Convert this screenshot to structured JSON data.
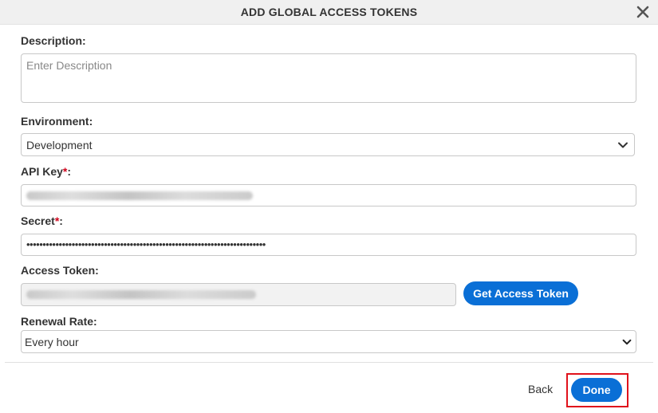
{
  "dialog": {
    "title": "ADD GLOBAL ACCESS TOKENS"
  },
  "form": {
    "description": {
      "label": "Description:",
      "placeholder": "Enter Description",
      "value": ""
    },
    "environment": {
      "label": "Environment:",
      "selected": "Development"
    },
    "api_key": {
      "label": "API Key",
      "required_mark": "*",
      "suffix": ":",
      "value_masked": "blurred"
    },
    "secret": {
      "label": "Secret",
      "required_mark": "*",
      "suffix": ":",
      "value": "••••••••••••••••••••••••••••••••••••••••••••••••••••••••••••••••••••••••••"
    },
    "access_token": {
      "label": "Access Token:",
      "value_masked": "blurred",
      "get_button_label": "Get Access Token"
    },
    "renewal_rate": {
      "label": "Renewal Rate:",
      "selected": "Every hour"
    }
  },
  "footer": {
    "back_label": "Back",
    "done_label": "Done"
  },
  "icons": {
    "close": "close-icon",
    "chevron": "chevron-down-icon"
  },
  "colors": {
    "primary": "#0a6fd6",
    "required": "#d0021b",
    "highlight": "#e0121b"
  }
}
